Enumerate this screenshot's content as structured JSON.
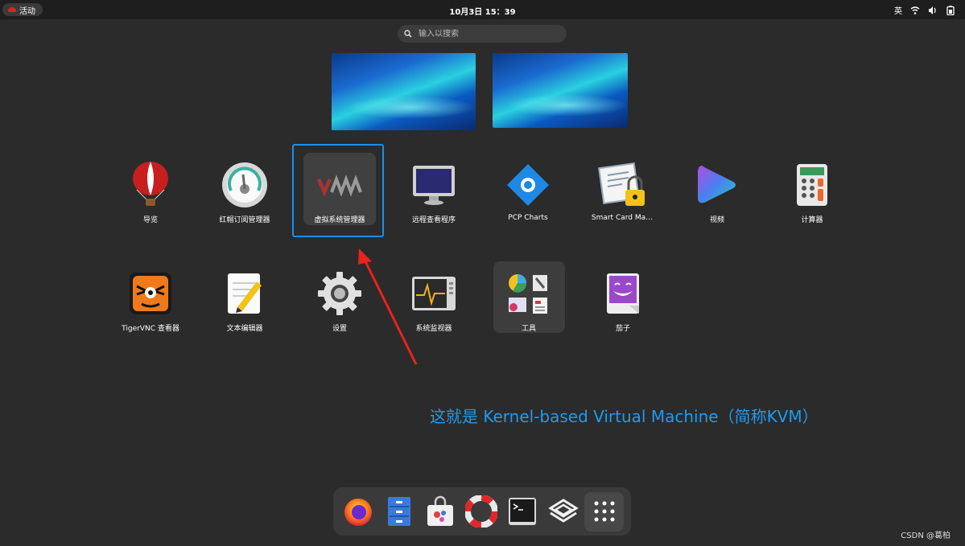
{
  "topbar": {
    "activities_label": "活动",
    "clock": "10月3日  15：39",
    "input_method": "英"
  },
  "search": {
    "placeholder": "输入以搜索"
  },
  "apps_row1": [
    {
      "label": "导览",
      "icon": "balloon-icon"
    },
    {
      "label": "红帽订阅管理器",
      "icon": "gauge-icon"
    },
    {
      "label": "虚拟系统管理器",
      "icon": "vmm-icon"
    },
    {
      "label": "远程查看程序",
      "icon": "monitor-icon"
    },
    {
      "label": "PCP Charts",
      "icon": "pcp-icon"
    },
    {
      "label": "Smart Card Ma…",
      "icon": "certificate-lock-icon"
    },
    {
      "label": "视频",
      "icon": "video-icon"
    },
    {
      "label": "计算器",
      "icon": "calculator-icon"
    }
  ],
  "apps_row2": [
    {
      "label": "TigerVNC 查看器",
      "icon": "tiger-icon"
    },
    {
      "label": "文本编辑器",
      "icon": "text-editor-icon"
    },
    {
      "label": "设置",
      "icon": "gear-icon"
    },
    {
      "label": "系统监视器",
      "icon": "system-monitor-icon"
    },
    {
      "label": "工具",
      "icon": "folder-icon"
    },
    {
      "label": "茄子",
      "icon": "cheese-icon"
    }
  ],
  "annotation": "这就是 Kernel-based Virtual Machine（简称KVM）",
  "dock": [
    "firefox-icon",
    "files-icon",
    "software-icon",
    "help-icon",
    "terminal-icon",
    "cockpit-icon",
    "app-grid-icon"
  ],
  "watermark": "CSDN @葛柏",
  "colors": {
    "highlight": "#1e8ee8",
    "annotation": "#1e9bf0",
    "arrow": "#e8221c"
  }
}
